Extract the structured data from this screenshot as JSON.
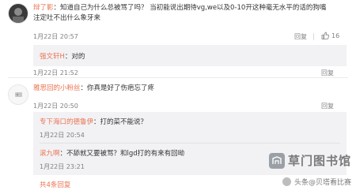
{
  "comment1": {
    "author": "辩了影",
    "separator": "：",
    "text_line1": "知道自己为什么总被骂了吗？ 当初能说出期待vg,we以及0-10开这种毫无水平的话的狗嘴",
    "text_line2": "注定吐不出什么象牙来",
    "time": "1月22日 20:57",
    "reply_label": "回复",
    "like_count": "16"
  },
  "reply1": {
    "author": "强文轩H",
    "text": "：对的",
    "time": "1月22日 21:52",
    "reply_label": "回复"
  },
  "comment2": {
    "author": "雅思回的小粉丝",
    "text": "：你真是好了伤疤忘了疼",
    "time": "1月22日 20:50",
    "reply_label": "回复"
  },
  "subreplies": [
    {
      "author": "专下海口的德鲁伊",
      "text": "：打的菜不能说？",
      "time": "1月22日 20:54"
    },
    {
      "author": "滚九啊",
      "text": "：不舔就又要被骂？和lgd打的有来有回呦",
      "time": "1月22日 23:21"
    }
  ],
  "view_more": "共4条回复",
  "watermark_text": "草门图书馆",
  "footer_text": "头条@贝塔看比赛",
  "colors": {
    "name": "#eb7350",
    "meta": "#808080",
    "reply_bg": "#f2f2f5"
  }
}
